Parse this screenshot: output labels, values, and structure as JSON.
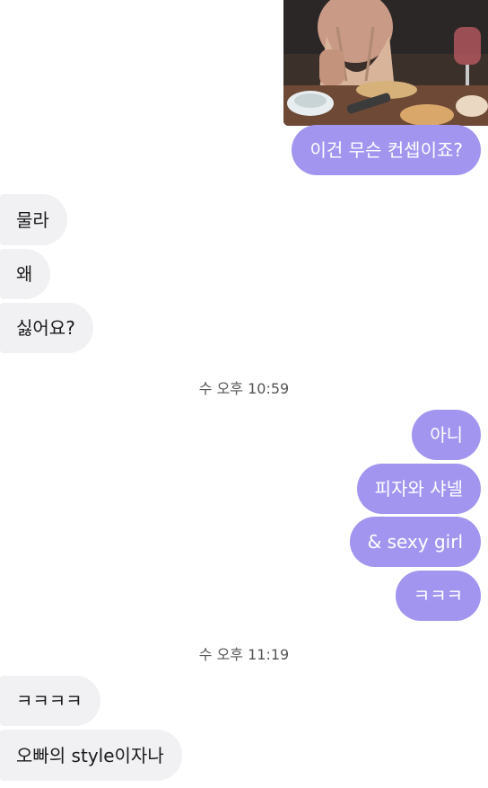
{
  "chat": {
    "messages": [
      {
        "side": "out",
        "text": "이건 무슨 컨셉이죠?"
      },
      {
        "side": "in",
        "text": "물라"
      },
      {
        "side": "in",
        "text": "왜"
      },
      {
        "side": "in",
        "text": "싫어요?"
      },
      {
        "side": "out",
        "text": "아니"
      },
      {
        "side": "out",
        "text": "피자와 샤넬"
      },
      {
        "side": "out",
        "text": "& sexy girl"
      },
      {
        "side": "out",
        "text": "ㅋㅋㅋ"
      },
      {
        "side": "in",
        "text": "ㅋㅋㅋㅋ"
      },
      {
        "side": "in",
        "text": "오빠의 style이자나"
      }
    ],
    "timestamps": [
      "수 오후 10:59",
      "수 오후 11:19"
    ]
  },
  "colors": {
    "outgoing_bubble": "#a195ef",
    "incoming_bubble": "#f1f1f4",
    "timestamp_text": "#555555"
  }
}
